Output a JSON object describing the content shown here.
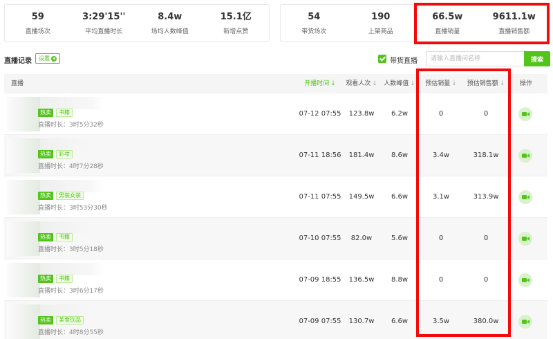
{
  "stats_left": [
    {
      "value": "59",
      "label": "直播场次"
    },
    {
      "value": "3:29'15''",
      "label": "平均直播时长"
    },
    {
      "value": "8.4w",
      "label": "场均人数峰值"
    },
    {
      "value": "15.1亿",
      "label": "新增点赞"
    }
  ],
  "stats_right": [
    {
      "value": "54",
      "label": "带货场次"
    },
    {
      "value": "190",
      "label": "上架商品"
    },
    {
      "value": "66.5w",
      "label": "直播销量"
    },
    {
      "value": "9611.1w",
      "label": "直播销售额"
    }
  ],
  "toolbar": {
    "section_title": "直播记录",
    "settings_label": "设置",
    "checkbox_label": "带货直播",
    "checkbox_checked": true,
    "search_placeholder": "请输入直播间名称",
    "search_button": "搜索"
  },
  "table": {
    "headers": {
      "live": "直播",
      "start_time": "开播时间",
      "viewers": "观看人次",
      "peak": "人数峰值",
      "est_sales": "预估销量",
      "est_revenue": "预估销售额",
      "action": "操作"
    },
    "sort_active": "start_time",
    "rows": [
      {
        "hot": "热卖",
        "category": "书籍",
        "duration": "直播时长：3时5分32秒",
        "start_time": "07-12 07:55",
        "viewers": "123.8w",
        "peak": "6.2w",
        "est_sales": "0",
        "est_revenue": "0"
      },
      {
        "hot": "热卖",
        "category": "彩妆",
        "duration": "直播时长：4时7分28秒",
        "start_time": "07-11 18:56",
        "viewers": "181.4w",
        "peak": "8.6w",
        "est_sales": "3.4w",
        "est_revenue": "318.1w"
      },
      {
        "hot": "热卖",
        "category": "男装女装",
        "duration": "直播时长：3时53分30秒",
        "start_time": "07-11 07:55",
        "viewers": "149.5w",
        "peak": "6.6w",
        "est_sales": "3.1w",
        "est_revenue": "313.9w"
      },
      {
        "hot": "热卖",
        "category": "书籍",
        "duration": "直播时长：3时5分18秒",
        "start_time": "07-10 07:55",
        "viewers": "82.0w",
        "peak": "5.6w",
        "est_sales": "0",
        "est_revenue": "0"
      },
      {
        "hot": "热卖",
        "category": "书籍",
        "duration": "直播时长：3时6分17秒",
        "start_time": "07-09 18:55",
        "viewers": "136.5w",
        "peak": "8.8w",
        "est_sales": "0",
        "est_revenue": "0"
      },
      {
        "hot": "热卖",
        "category": "美食饮品",
        "duration": "直播时长：4时8分55秒",
        "start_time": "07-09 07:55",
        "viewers": "130.7w",
        "peak": "6.6w",
        "est_sales": "3.5w",
        "est_revenue": "380.0w"
      }
    ]
  },
  "colors": {
    "accent": "#52c41a",
    "highlight_box": "#f50a0a"
  },
  "icons": {
    "settings": "gear-icon",
    "action": "video-camera-icon",
    "sort": "sort-arrow-icon"
  }
}
